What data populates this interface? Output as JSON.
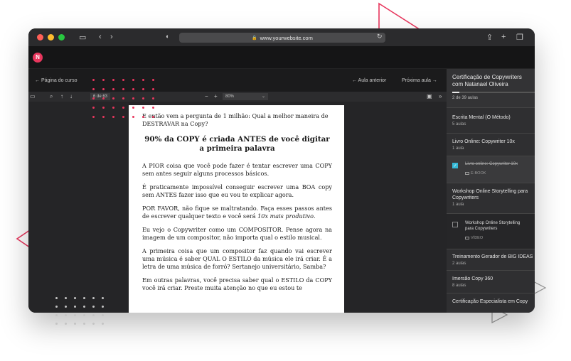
{
  "colors": {
    "accent": "#e8365d",
    "check": "#35b8d6"
  },
  "browser": {
    "url": "www.yourwebsite.com",
    "icons": [
      "sidebar-toggle-icon",
      "back-icon",
      "forward-icon",
      "shield-icon",
      "lock-icon",
      "reload-icon",
      "share-icon",
      "new-tab-icon",
      "tabs-icon"
    ]
  },
  "app": {
    "logo": "N"
  },
  "nav": {
    "back": "← Página do curso",
    "prev": "← Aula anterior",
    "next": "Próxima aula →"
  },
  "pdf": {
    "page": "6 de 63",
    "zoom": "80%",
    "zoom_minus": "−",
    "zoom_plus": "+"
  },
  "doc": {
    "intro": "E então vem a pergunta de 1 milhão: Qual a melhor maneira de DESTRAVAR na Copy?",
    "heading": "90% da COPY é criada ANTES de você digitar a primeira palavra",
    "p1": "A PIOR coisa que você pode fazer é tentar escrever uma COPY sem antes seguir alguns processos básicos.",
    "p2": "É praticamente impossível conseguir escrever uma BOA copy sem ANTES fazer isso que eu vou te explicar agora.",
    "p3a": "POR FAVOR, não fique se maltratando. Faça esses passos antes de escrever qualquer texto e você será ",
    "p3b": "10x mais produtivo",
    "p3c": ".",
    "p4": "Eu vejo o Copywriter como um COMPOSITOR. Pense agora na imagem de um compositor, não importa qual o estilo musical.",
    "p5": "A primeira coisa que um compositor faz quando vai escrever uma música é saber QUAL O ESTILO da música ele irá criar. É a letra de uma música de forró? Sertanejo universitário, Samba?",
    "p6": "Em outras palavras, você precisa saber qual o ESTILO da COPY você irá criar. Preste muita atenção no que eu estou te"
  },
  "sidebar": {
    "title_line1": "Certificação de Copywriters",
    "title_line2": "com Natanael Oliveira",
    "progress": 0.08,
    "count": "2 de 39 aulas",
    "modules": [
      {
        "title": "Escrita Mental (O Método)",
        "sub": "5 aulas"
      },
      {
        "title": "Livro Online: Copywriter 10x",
        "sub": "1 aula"
      },
      {
        "title": "Workshop Online Storytelling para Copywriters",
        "sub": "1 aula"
      },
      {
        "title": "Treinamento Gerador de BIG IDEAS",
        "sub": "2 aulas"
      },
      {
        "title": "Imersão Copy 360",
        "sub": "8 aulas"
      },
      {
        "title": "Certificação Especialista em Copy",
        "sub": ""
      }
    ],
    "lesson1": {
      "title": "Livro online: Copywriter 10x",
      "type": "E-BOOK"
    },
    "lesson2": {
      "title": "Workshop Online Storytelling para Copywriters",
      "type": "VÍDEO"
    }
  }
}
